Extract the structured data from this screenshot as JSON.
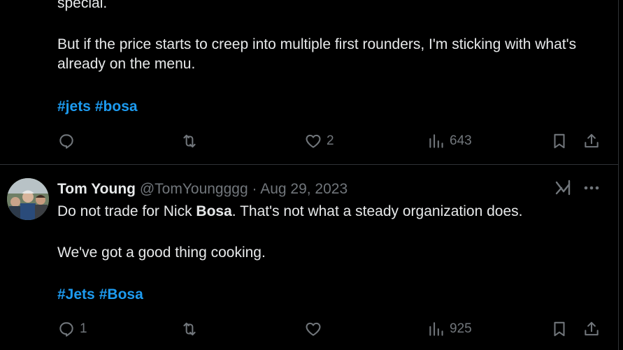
{
  "tweet1": {
    "text_top": "special.",
    "text_para": "But if the price starts to creep into multiple first rounders, I'm sticking with what's already on the menu.",
    "hashtags": [
      "#jets",
      "#bosa"
    ],
    "actions": {
      "reply_count": "",
      "retweet_count": "",
      "like_count": "2",
      "views_count": "643"
    }
  },
  "tweet2": {
    "author_name": "Tom Young",
    "author_handle": "@TomYoungggg",
    "separator": "·",
    "date": "Aug 29, 2023",
    "text_before_bold": "Do not trade for Nick ",
    "text_bold": "Bosa",
    "text_after_bold": ". That's not what a steady organization does.",
    "text_para2": "We've got a good thing cooking.",
    "hashtags": [
      "#Jets",
      "#Bosa"
    ],
    "actions": {
      "reply_count": "1",
      "retweet_count": "",
      "like_count": "",
      "views_count": "925"
    }
  },
  "icons": {
    "reply": "reply-icon",
    "retweet": "retweet-icon",
    "like": "heart-icon",
    "views": "views-icon",
    "bookmark": "bookmark-icon",
    "share": "share-icon",
    "grok": "grok-icon",
    "more": "more-icon"
  },
  "colors": {
    "background": "#000000",
    "text": "#e7e9ea",
    "muted": "#71767b",
    "link": "#1d9bf0",
    "divider": "#2f3336"
  }
}
